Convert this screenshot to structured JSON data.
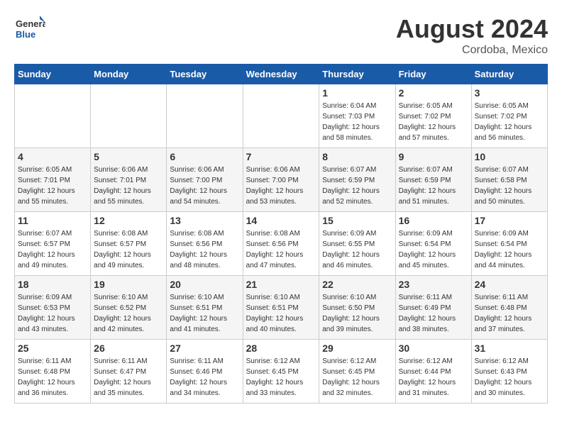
{
  "logo": {
    "line1": "General",
    "line2": "Blue"
  },
  "header": {
    "month": "August 2024",
    "location": "Cordoba, Mexico"
  },
  "weekdays": [
    "Sunday",
    "Monday",
    "Tuesday",
    "Wednesday",
    "Thursday",
    "Friday",
    "Saturday"
  ],
  "weeks": [
    [
      {
        "day": "",
        "info": ""
      },
      {
        "day": "",
        "info": ""
      },
      {
        "day": "",
        "info": ""
      },
      {
        "day": "",
        "info": ""
      },
      {
        "day": "1",
        "info": "Sunrise: 6:04 AM\nSunset: 7:03 PM\nDaylight: 12 hours\nand 58 minutes."
      },
      {
        "day": "2",
        "info": "Sunrise: 6:05 AM\nSunset: 7:02 PM\nDaylight: 12 hours\nand 57 minutes."
      },
      {
        "day": "3",
        "info": "Sunrise: 6:05 AM\nSunset: 7:02 PM\nDaylight: 12 hours\nand 56 minutes."
      }
    ],
    [
      {
        "day": "4",
        "info": "Sunrise: 6:05 AM\nSunset: 7:01 PM\nDaylight: 12 hours\nand 55 minutes."
      },
      {
        "day": "5",
        "info": "Sunrise: 6:06 AM\nSunset: 7:01 PM\nDaylight: 12 hours\nand 55 minutes."
      },
      {
        "day": "6",
        "info": "Sunrise: 6:06 AM\nSunset: 7:00 PM\nDaylight: 12 hours\nand 54 minutes."
      },
      {
        "day": "7",
        "info": "Sunrise: 6:06 AM\nSunset: 7:00 PM\nDaylight: 12 hours\nand 53 minutes."
      },
      {
        "day": "8",
        "info": "Sunrise: 6:07 AM\nSunset: 6:59 PM\nDaylight: 12 hours\nand 52 minutes."
      },
      {
        "day": "9",
        "info": "Sunrise: 6:07 AM\nSunset: 6:59 PM\nDaylight: 12 hours\nand 51 minutes."
      },
      {
        "day": "10",
        "info": "Sunrise: 6:07 AM\nSunset: 6:58 PM\nDaylight: 12 hours\nand 50 minutes."
      }
    ],
    [
      {
        "day": "11",
        "info": "Sunrise: 6:07 AM\nSunset: 6:57 PM\nDaylight: 12 hours\nand 49 minutes."
      },
      {
        "day": "12",
        "info": "Sunrise: 6:08 AM\nSunset: 6:57 PM\nDaylight: 12 hours\nand 49 minutes."
      },
      {
        "day": "13",
        "info": "Sunrise: 6:08 AM\nSunset: 6:56 PM\nDaylight: 12 hours\nand 48 minutes."
      },
      {
        "day": "14",
        "info": "Sunrise: 6:08 AM\nSunset: 6:56 PM\nDaylight: 12 hours\nand 47 minutes."
      },
      {
        "day": "15",
        "info": "Sunrise: 6:09 AM\nSunset: 6:55 PM\nDaylight: 12 hours\nand 46 minutes."
      },
      {
        "day": "16",
        "info": "Sunrise: 6:09 AM\nSunset: 6:54 PM\nDaylight: 12 hours\nand 45 minutes."
      },
      {
        "day": "17",
        "info": "Sunrise: 6:09 AM\nSunset: 6:54 PM\nDaylight: 12 hours\nand 44 minutes."
      }
    ],
    [
      {
        "day": "18",
        "info": "Sunrise: 6:09 AM\nSunset: 6:53 PM\nDaylight: 12 hours\nand 43 minutes."
      },
      {
        "day": "19",
        "info": "Sunrise: 6:10 AM\nSunset: 6:52 PM\nDaylight: 12 hours\nand 42 minutes."
      },
      {
        "day": "20",
        "info": "Sunrise: 6:10 AM\nSunset: 6:51 PM\nDaylight: 12 hours\nand 41 minutes."
      },
      {
        "day": "21",
        "info": "Sunrise: 6:10 AM\nSunset: 6:51 PM\nDaylight: 12 hours\nand 40 minutes."
      },
      {
        "day": "22",
        "info": "Sunrise: 6:10 AM\nSunset: 6:50 PM\nDaylight: 12 hours\nand 39 minutes."
      },
      {
        "day": "23",
        "info": "Sunrise: 6:11 AM\nSunset: 6:49 PM\nDaylight: 12 hours\nand 38 minutes."
      },
      {
        "day": "24",
        "info": "Sunrise: 6:11 AM\nSunset: 6:48 PM\nDaylight: 12 hours\nand 37 minutes."
      }
    ],
    [
      {
        "day": "25",
        "info": "Sunrise: 6:11 AM\nSunset: 6:48 PM\nDaylight: 12 hours\nand 36 minutes."
      },
      {
        "day": "26",
        "info": "Sunrise: 6:11 AM\nSunset: 6:47 PM\nDaylight: 12 hours\nand 35 minutes."
      },
      {
        "day": "27",
        "info": "Sunrise: 6:11 AM\nSunset: 6:46 PM\nDaylight: 12 hours\nand 34 minutes."
      },
      {
        "day": "28",
        "info": "Sunrise: 6:12 AM\nSunset: 6:45 PM\nDaylight: 12 hours\nand 33 minutes."
      },
      {
        "day": "29",
        "info": "Sunrise: 6:12 AM\nSunset: 6:45 PM\nDaylight: 12 hours\nand 32 minutes."
      },
      {
        "day": "30",
        "info": "Sunrise: 6:12 AM\nSunset: 6:44 PM\nDaylight: 12 hours\nand 31 minutes."
      },
      {
        "day": "31",
        "info": "Sunrise: 6:12 AM\nSunset: 6:43 PM\nDaylight: 12 hours\nand 30 minutes."
      }
    ]
  ]
}
